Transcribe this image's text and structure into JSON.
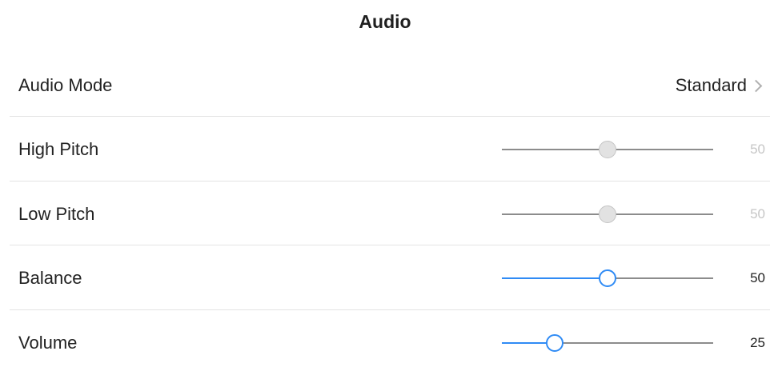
{
  "title": "Audio",
  "audio_mode": {
    "label": "Audio Mode",
    "value": "Standard"
  },
  "settings": [
    {
      "label": "High Pitch",
      "value": "50",
      "level": 0.5,
      "enabled": false
    },
    {
      "label": "Low Pitch",
      "value": "50",
      "level": 0.5,
      "enabled": false
    },
    {
      "label": "Balance",
      "value": "50",
      "level": 0.5,
      "enabled": true
    },
    {
      "label": "Volume",
      "value": "25",
      "level": 0.25,
      "enabled": true
    }
  ],
  "colors": {
    "accent": "#2f8bf5",
    "track": "#8c8c8c",
    "disabled_text": "#c6c6c6",
    "divider": "#e4e4e4"
  },
  "icons": {
    "audio_mode_chevron": "chevron-right-icon"
  }
}
